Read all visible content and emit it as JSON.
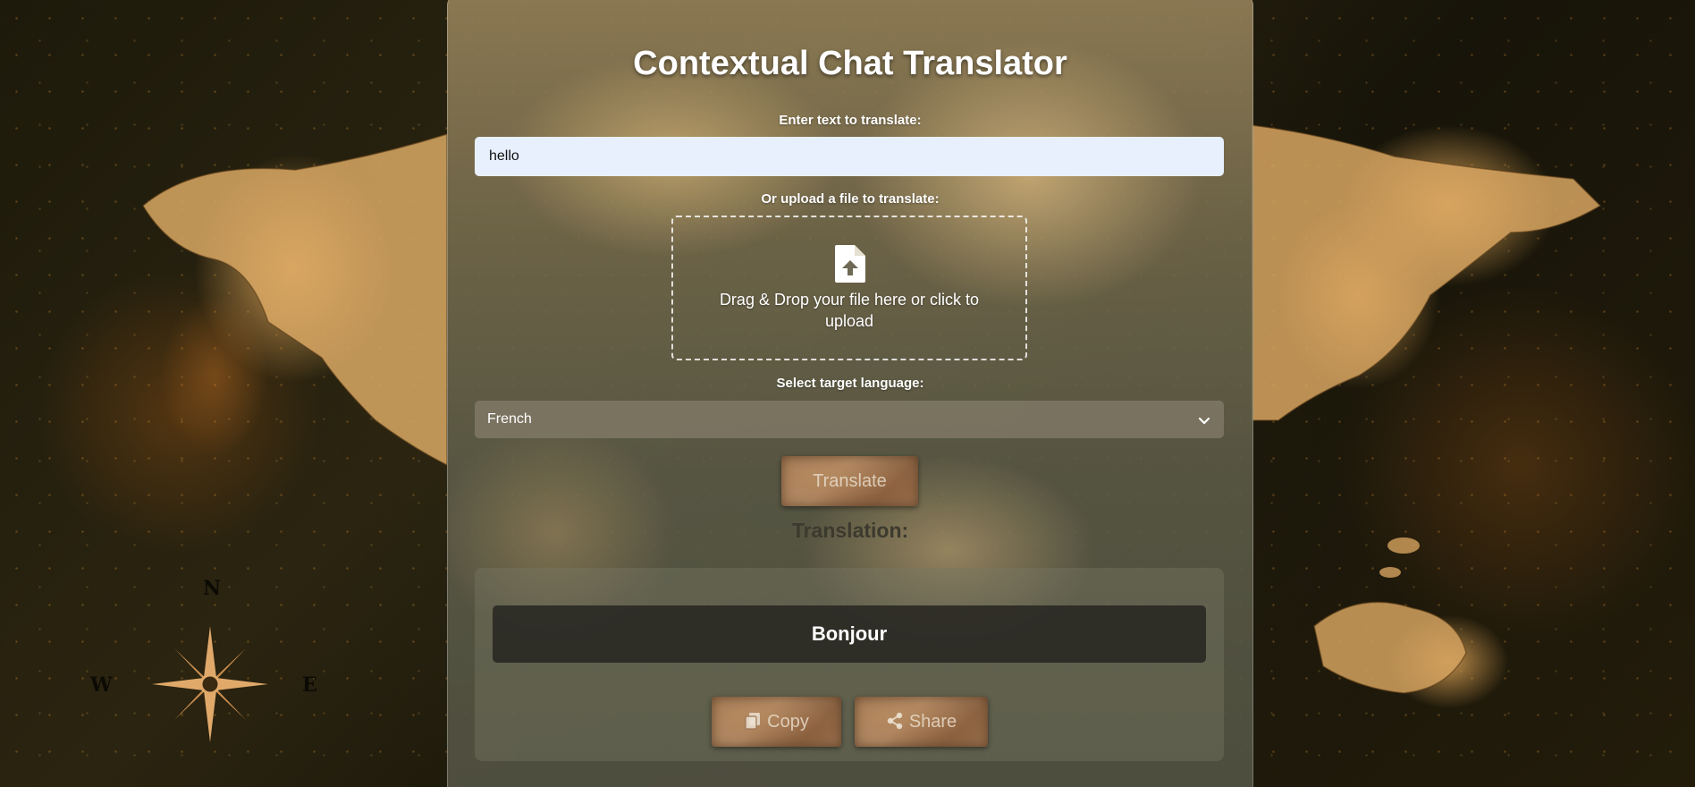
{
  "app": {
    "title": "Contextual Chat Translator"
  },
  "text_input": {
    "label": "Enter text to translate:",
    "value": "hello"
  },
  "file_upload": {
    "label": "Or upload a file to translate:",
    "dropzone_text": "Drag & Drop your file here or click to upload",
    "icon": "file-upload-icon"
  },
  "language_select": {
    "label": "Select target language:",
    "selected": "French",
    "icon": "chevron-down-icon"
  },
  "actions": {
    "translate_label": "Translate"
  },
  "result": {
    "heading": "Translation:",
    "text": "Bonjour",
    "copy_label": "Copy",
    "share_label": "Share"
  },
  "background": {
    "compass_letters": [
      "N",
      "W",
      "E"
    ]
  },
  "colors": {
    "input_bg": "#e8f0fe",
    "result_bg": "#262420",
    "button_parchment": "#9c7553"
  }
}
